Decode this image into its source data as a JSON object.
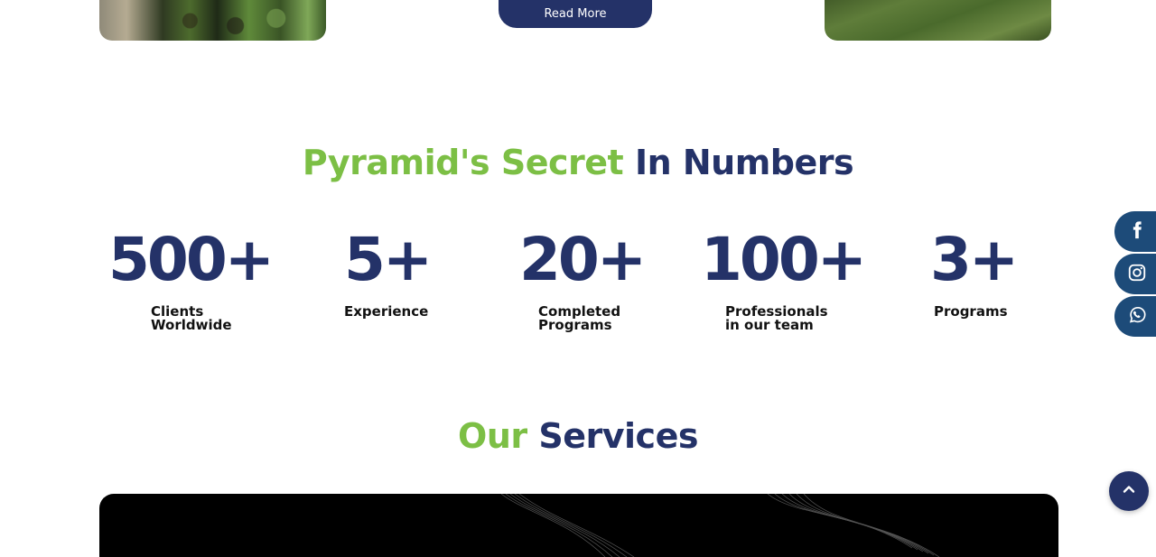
{
  "top": {
    "read_more_label": "Read More"
  },
  "numbers_section": {
    "title_highlight": "Pyramid's Secret",
    "title_rest": "In Numbers",
    "stats": [
      {
        "value": "500+",
        "label": "Clients\nWorldwide"
      },
      {
        "value": "5+",
        "label": "Experience"
      },
      {
        "value": "20+",
        "label": "Completed\nPrograms"
      },
      {
        "value": "100+",
        "label": "Professionals\nin our team"
      },
      {
        "value": "3+",
        "label": "Programs"
      }
    ]
  },
  "services_section": {
    "title_highlight": "Our",
    "title_rest": "Services"
  },
  "social": [
    "facebook-icon",
    "instagram-icon",
    "whatsapp-icon"
  ],
  "colors": {
    "navy": "#243268",
    "green": "#7cbf45",
    "social_bg": "#1d4b79"
  }
}
